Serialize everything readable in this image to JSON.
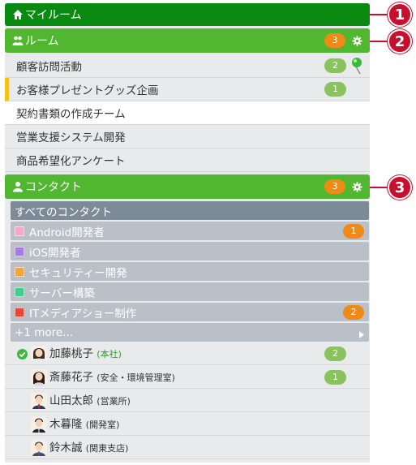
{
  "my_room": {
    "label": "マイルーム"
  },
  "rooms": {
    "label": "ルーム",
    "badge": "3",
    "items": [
      {
        "label": "顧客訪問活動",
        "badge": "2"
      },
      {
        "label": "お客様プレゼントグッズ企画",
        "badge": "1"
      },
      {
        "label": "契約書類の作成チーム"
      },
      {
        "label": "営業支援システム開発"
      },
      {
        "label": "商品希望化アンケート"
      }
    ]
  },
  "contacts": {
    "label": "コンタクト",
    "badge": "3",
    "all_label": "すべてのコンタクト",
    "categories": [
      {
        "label": "Android開発者",
        "color": "#f7a8c4",
        "badge": "1"
      },
      {
        "label": "iOS開発者",
        "color": "#a77be0"
      },
      {
        "label": "セキュリティー開発",
        "color": "#f5a540"
      },
      {
        "label": "サーバー構築",
        "color": "#3ecf8e"
      },
      {
        "label": "ITメディアショー制作",
        "color": "#ee4433",
        "badge": "2"
      }
    ],
    "more_label": "+1 more...",
    "people": [
      {
        "name": "加藤桃子",
        "dept": "(本社)",
        "badge": "2"
      },
      {
        "name": "斎藤花子",
        "dept": "(安全・環境管理室)",
        "badge": "1"
      },
      {
        "name": "山田太郎",
        "dept": "(営業所)"
      },
      {
        "name": "木暮隆",
        "dept": "(開発室)"
      },
      {
        "name": "鈴木誠",
        "dept": "(関東支店)"
      }
    ]
  },
  "callouts": [
    "1",
    "2",
    "3"
  ],
  "colors": {
    "dark_green": "#0b8a12",
    "green": "#52b730",
    "orange": "#f08a16",
    "callout_red": "#c8102e"
  },
  "icons": [
    "home-icon",
    "group-icon",
    "person-icon",
    "gear-icon",
    "pin-icon",
    "checkmark-icon",
    "chevron-right-icon"
  ]
}
